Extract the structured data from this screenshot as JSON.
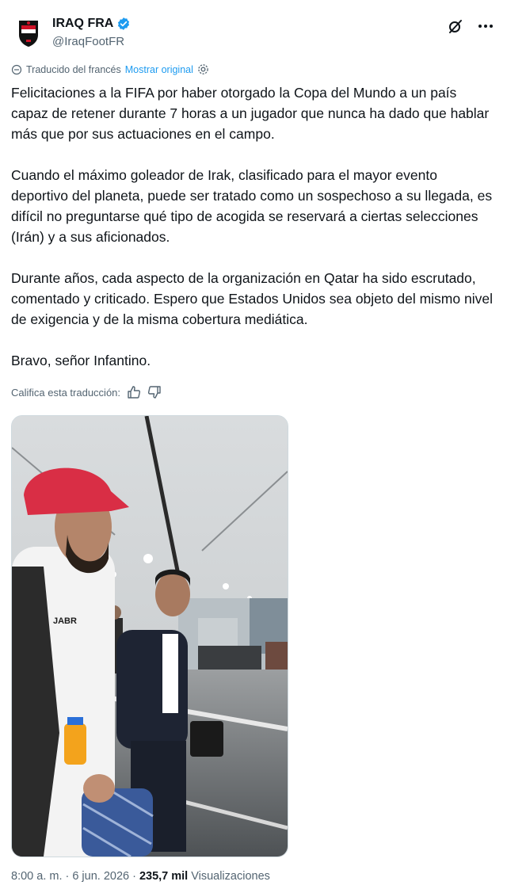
{
  "author": {
    "display_name": "IRAQ FRA",
    "handle": "@IraqFootFR"
  },
  "translation": {
    "label": "Traducido del francés",
    "show_original": "Mostrar original",
    "rate_label": "Califica esta traducción:"
  },
  "tweet": {
    "paragraphs": [
      "Felicitaciones a la FIFA por haber otorgado la Copa del Mundo a un país capaz de retener durante 7 horas a un jugador que nunca ha dado que hablar más que por sus actuaciones en el campo.",
      "Cuando el máximo goleador de Irak, clasificado para el mayor evento deportivo del planeta, puede ser tratado como un sospechoso a su llegada, es difícil no preguntarse qué tipo de acogida se reservará a ciertas selecciones (Irán) y a sus aficionados.",
      "Durante años, cada aspecto de la organización en Qatar ha sido escrutado, comentado y criticado. Espero que Estados Unidos sea objeto del mismo nivel de exigencia y de la misma cobertura mediática.",
      "Bravo, señor Infantino."
    ]
  },
  "media": {
    "jacket_text": "JABR"
  },
  "meta": {
    "time": "8:00 a. m.",
    "separator": "·",
    "date": "6 jun. 2026",
    "views_count": "235,7 mil",
    "views_label": "Visualizaciones"
  },
  "colors": {
    "accent": "#1d9bf0",
    "text": "#0f1419",
    "secondary": "#536471"
  },
  "icons": [
    "iraq-crest-icon",
    "verified-badge-icon",
    "grok-icon",
    "more-icon",
    "settings-icon",
    "thumbs-up-icon",
    "thumbs-down-icon"
  ]
}
